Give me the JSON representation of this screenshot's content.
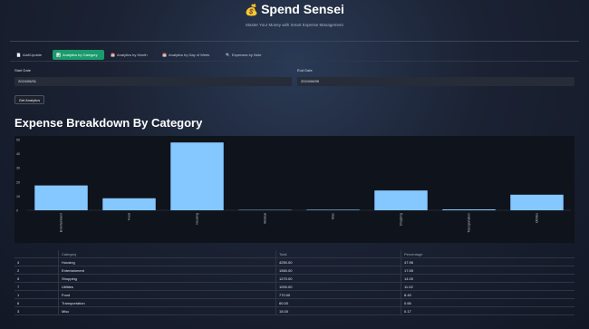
{
  "app": {
    "title": "Spend Sensei",
    "title_icon": "💰",
    "subtitle": "Master Your Money with Smart Expense Management"
  },
  "tabs": [
    {
      "label": "Add/Update",
      "icon": "📄",
      "active": false
    },
    {
      "label": "Analytics by Category",
      "icon": "📊",
      "active": true
    },
    {
      "label": "Analytics by Month",
      "icon": "📅",
      "active": false
    },
    {
      "label": "Analytics by Day of Week",
      "icon": "📅",
      "active": false
    },
    {
      "label": "Expenses by Note",
      "icon": "🔍",
      "active": false
    }
  ],
  "form": {
    "start_label": "Start Date",
    "start_value": "2024/08/01",
    "end_label": "End Date",
    "end_value": "2024/08/05",
    "button_label": "Get Analytics"
  },
  "section_title": "Expense Breakdown By Category",
  "chart_data": {
    "type": "bar",
    "categories": [
      "Entertainment",
      "Food",
      "Housing",
      "Medical",
      "Misc",
      "Shopping",
      "Transportation",
      "Utilities"
    ],
    "values": [
      17.55,
      8.49,
      47.96,
      0.0,
      0.17,
      14.0,
      0.66,
      11.02
    ],
    "ylim": [
      0,
      50
    ],
    "yticks": [
      "0",
      "10",
      "20",
      "30",
      "40",
      "50"
    ],
    "bar_color": "#85c7ff",
    "grid": false
  },
  "table": {
    "headers": [
      "",
      "Category",
      "Total",
      "Percentage"
    ],
    "rows": [
      [
        "4",
        "Housing",
        "4250.00",
        "47.96"
      ],
      [
        "2",
        "Entertainment",
        "1560.00",
        "17.55"
      ],
      [
        "5",
        "Shopping",
        "1270.00",
        "14.00"
      ],
      [
        "7",
        "Utilities",
        "1000.00",
        "11.02"
      ],
      [
        "1",
        "Food",
        "770.00",
        "8.49"
      ],
      [
        "6",
        "Transportation",
        "60.00",
        "0.66"
      ],
      [
        "3",
        "Misc",
        "15.00",
        "0.17"
      ]
    ]
  }
}
